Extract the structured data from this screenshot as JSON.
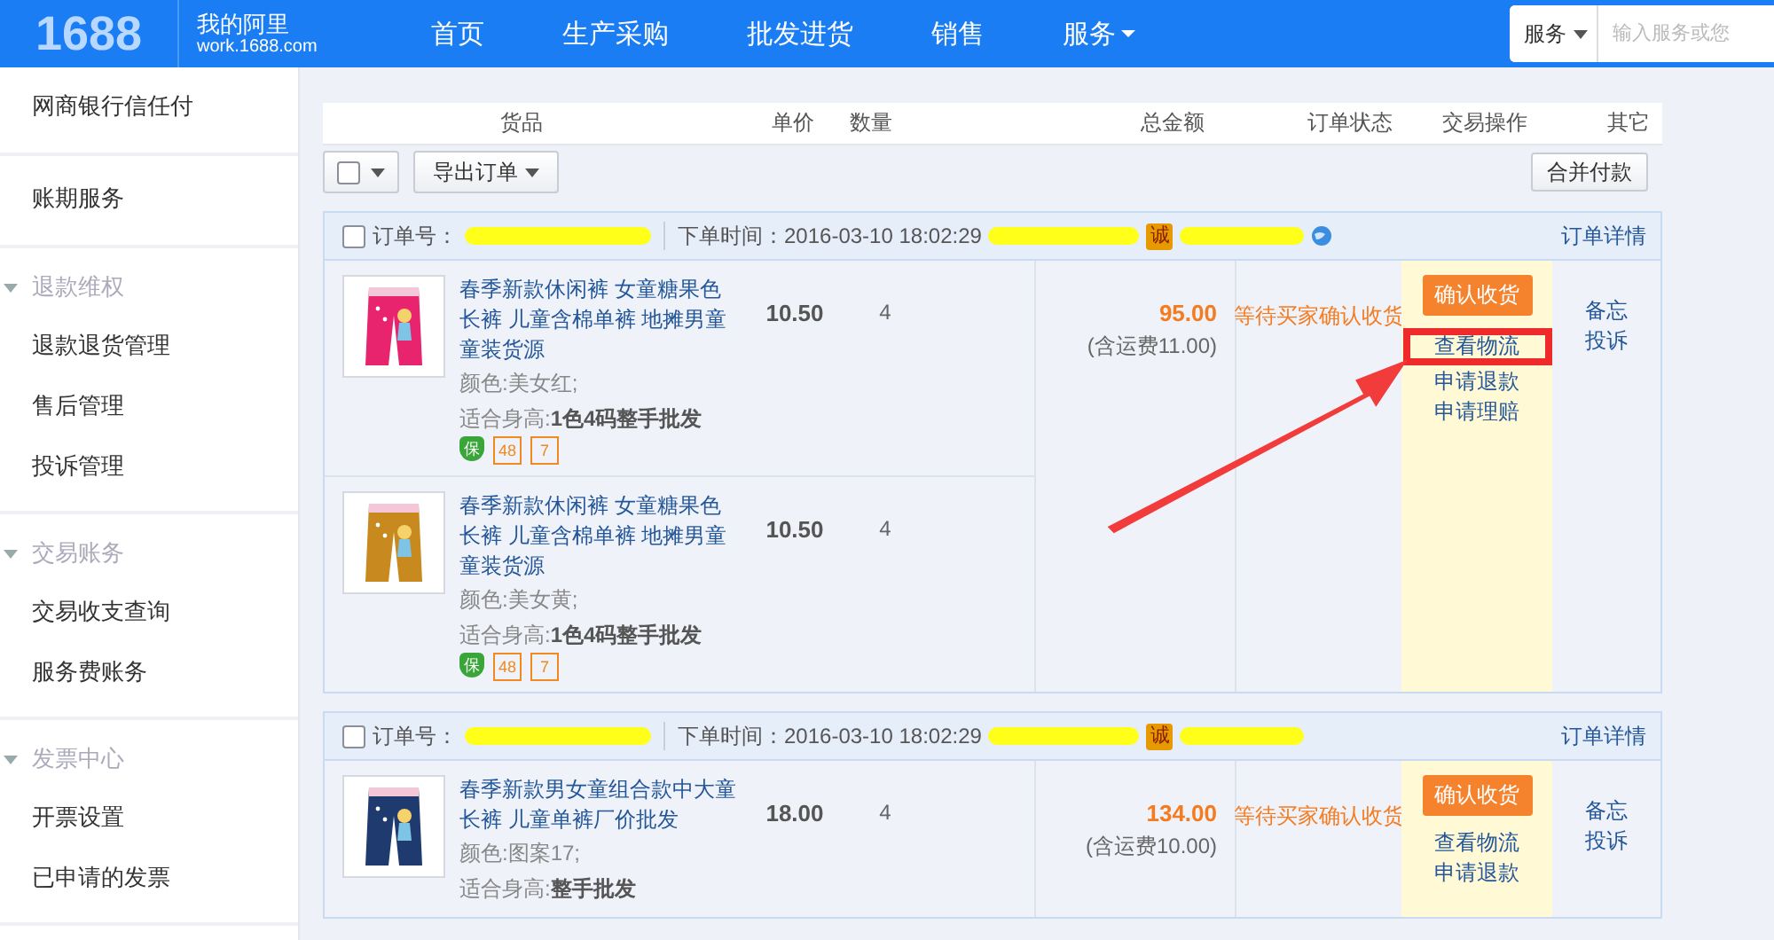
{
  "header": {
    "logo": "1688",
    "brand": "我的阿里",
    "site": "work.1688.com",
    "nav": [
      {
        "label": "首页",
        "has_menu": false
      },
      {
        "label": "生产采购",
        "has_menu": false
      },
      {
        "label": "批发进货",
        "has_menu": false
      },
      {
        "label": "销售",
        "has_menu": false
      },
      {
        "label": "服务",
        "has_menu": true
      }
    ],
    "search": {
      "scope": "服务",
      "placeholder": "输入服务或您"
    }
  },
  "sidebar": [
    {
      "items": [
        "网商银行信任付"
      ]
    },
    {
      "items": [
        "账期服务"
      ]
    },
    {
      "title": "退款维权",
      "expanded": true,
      "items": [
        "退款退货管理",
        "售后管理",
        "投诉管理"
      ]
    },
    {
      "title": "交易账务",
      "expanded": true,
      "items": [
        "交易收支查询",
        "服务费账务"
      ]
    },
    {
      "title": "发票中心",
      "expanded": true,
      "items": [
        "开票设置",
        "已申请的发票"
      ]
    }
  ],
  "table": {
    "columns": [
      "货品",
      "单价",
      "数量",
      "总金额",
      "订单状态",
      "交易操作",
      "其它"
    ],
    "select_all": {
      "checked": false
    },
    "export_button": "导出订单",
    "merge_button": "合并付款"
  },
  "orders": [
    {
      "checked": false,
      "order_label": "订单号：",
      "time_label": "下单时间：",
      "time": "2016-03-10 18:02:29",
      "trust_badge": "诚",
      "detail_link": "订单详情",
      "items": [
        {
          "title": "春季新款休闲裤 女童糖果色长裤 儿童含棉单裤 地摊男童童装货源",
          "variant_label": "颜色:",
          "variant": "美女红;",
          "size_label": "适合身高:",
          "size": "1色4码整手批发",
          "price": "10.50",
          "qty": "4",
          "badges": [
            {
              "kind": "guarantee",
              "text": "保"
            },
            {
              "kind": "hours",
              "text": "48"
            },
            {
              "kind": "days",
              "text": "7"
            }
          ]
        },
        {
          "title": "春季新款休闲裤 女童糖果色长裤 儿童含棉单裤 地摊男童童装货源",
          "variant_label": "颜色:",
          "variant": "美女黄;",
          "size_label": "适合身高:",
          "size": "1色4码整手批发",
          "price": "10.50",
          "qty": "4",
          "badges": [
            {
              "kind": "guarantee",
              "text": "保"
            },
            {
              "kind": "hours",
              "text": "48"
            },
            {
              "kind": "days",
              "text": "7"
            }
          ]
        }
      ],
      "total": "95.00",
      "shipping": "(含运费11.00)",
      "status": "等待买家确认收货",
      "confirm_button": "确认收货",
      "links": [
        {
          "label": "查看物流",
          "highlighted": true
        },
        {
          "label": "申请退款",
          "highlighted": false
        },
        {
          "label": "申请理赔",
          "highlighted": false
        }
      ],
      "other_links": [
        "备忘",
        "投诉"
      ],
      "arrow": true
    },
    {
      "checked": false,
      "order_label": "订单号：",
      "time_label": "下单时间：",
      "time": "2016-03-10 18:02:29",
      "trust_badge": "诚",
      "detail_link": "订单详情",
      "items": [
        {
          "title": "春季新款男女童组合款中大童长裤 儿童单裤厂价批发",
          "variant_label": "颜色:",
          "variant": "图案17;",
          "size_label": "适合身高:",
          "size": "整手批发",
          "price": "18.00",
          "qty": "4"
        }
      ],
      "total": "134.00",
      "shipping": "(含运费10.00)",
      "status": "等待买家确认收货",
      "confirm_button": "确认收货",
      "links": [
        {
          "label": "查看物流",
          "highlighted": false
        },
        {
          "label": "申请退款",
          "highlighted": false
        }
      ],
      "other_links": [
        "备忘",
        "投诉"
      ]
    }
  ]
}
